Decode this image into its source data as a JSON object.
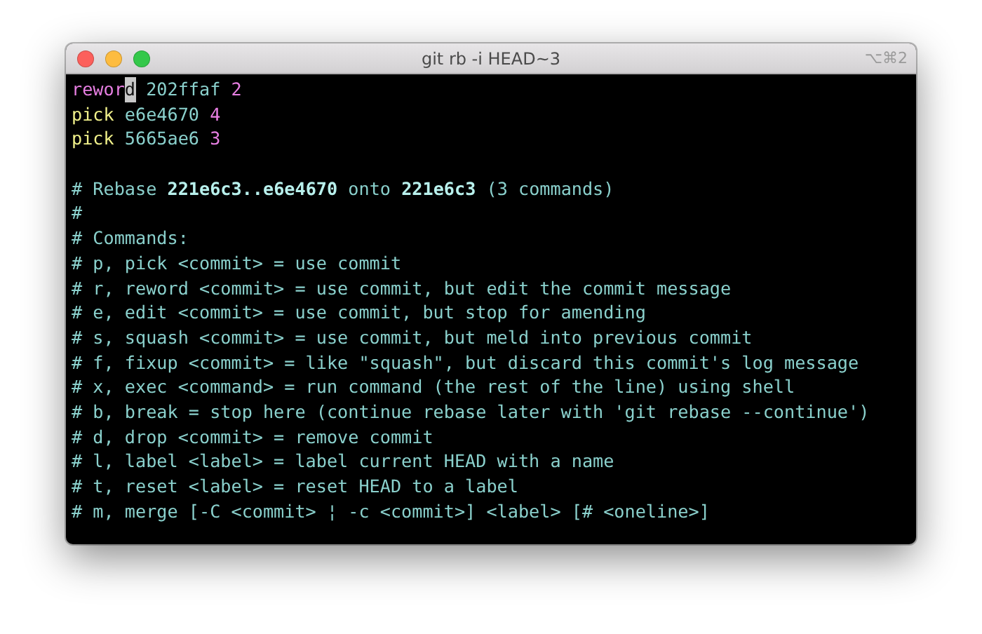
{
  "window": {
    "title": "git rb -i HEAD~3",
    "shortcut": "⌥⌘2"
  },
  "lines": [
    {
      "kind": "todo",
      "segments": [
        {
          "kind": "command",
          "text": "rewor"
        },
        {
          "kind": "cursor",
          "text": "d"
        },
        {
          "kind": "hash",
          "text": "202ffaf"
        },
        {
          "kind": "note",
          "text": "2"
        }
      ]
    },
    {
      "kind": "todo",
      "segments": [
        {
          "kind": "command2",
          "text": "pick"
        },
        {
          "kind": "hash",
          "text": "e6e4670"
        },
        {
          "kind": "note",
          "text": "4"
        }
      ]
    },
    {
      "kind": "todo",
      "segments": [
        {
          "kind": "command2",
          "text": "pick"
        },
        {
          "kind": "hash",
          "text": "5665ae6"
        },
        {
          "kind": "note",
          "text": "3"
        }
      ]
    },
    {
      "kind": "blank"
    },
    {
      "kind": "comment",
      "text": "# Rebase **221e6c3..e6e4670** onto **221e6c3** (3 commands)"
    },
    {
      "kind": "comment",
      "text": "#"
    },
    {
      "kind": "comment",
      "text": "# Commands:"
    },
    {
      "kind": "comment",
      "text": "# p, pick <commit> = use commit"
    },
    {
      "kind": "comment",
      "text": "# r, reword <commit> = use commit, but edit the commit message"
    },
    {
      "kind": "comment",
      "text": "# e, edit <commit> = use commit, but stop for amending"
    },
    {
      "kind": "comment",
      "text": "# s, squash <commit> = use commit, but meld into previous commit"
    },
    {
      "kind": "comment",
      "text": "# f, fixup <commit> = like \"squash\", but discard this commit's log message"
    },
    {
      "kind": "comment",
      "text": "# x, exec <command> = run command (the rest of the line) using shell"
    },
    {
      "kind": "comment",
      "text": "# b, break = stop here (continue rebase later with 'git rebase --continue')"
    },
    {
      "kind": "comment",
      "text": "# d, drop <commit> = remove commit"
    },
    {
      "kind": "comment",
      "text": "# l, label <label> = label current HEAD with a name"
    },
    {
      "kind": "comment",
      "text": "# t, reset <label> = reset HEAD to a label"
    },
    {
      "kind": "comment",
      "text": "# m, merge [-C <commit> ¦ -c <commit>] <label> [# <oneline>]"
    }
  ]
}
